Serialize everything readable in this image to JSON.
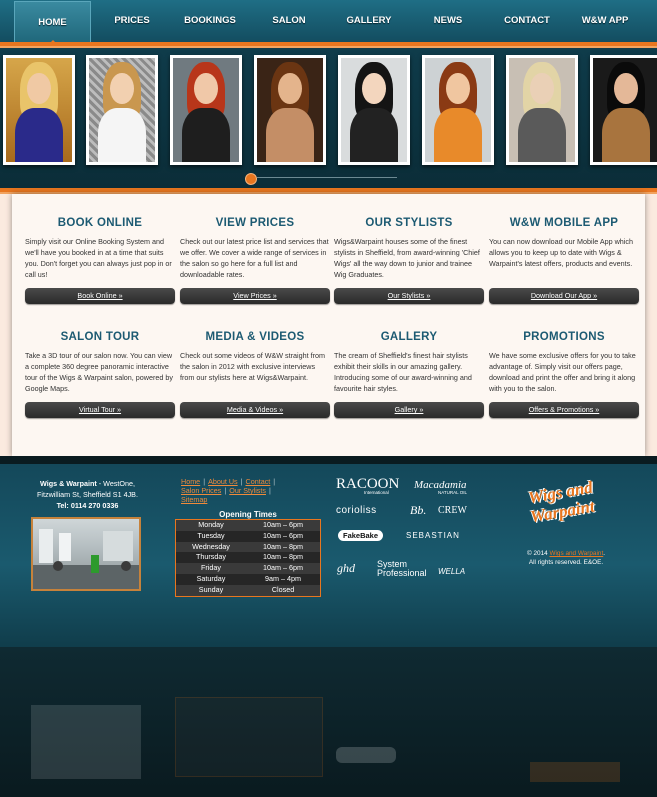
{
  "nav": {
    "items": [
      "HOME",
      "PRICES",
      "BOOKINGS",
      "SALON",
      "GALLERY",
      "NEWS",
      "CONTACT",
      "W&W APP"
    ],
    "active_index": 0
  },
  "colors": {
    "nav_bg": "#1b6175",
    "accent_orange": "#e8761f",
    "heading_blue": "#1c5a72",
    "panel_bg": "#fdf7f2",
    "button_dark": "#333333"
  },
  "carousel": {
    "photo_count": 8
  },
  "cards": [
    {
      "title": "BOOK ONLINE",
      "text": "Simply visit our Online Booking System and we'll have you booked in at a time that suits you. Don't forget you can always just pop in or call us!",
      "button": "Book Online »"
    },
    {
      "title": "VIEW PRICES",
      "text": "Check out our latest price list and services that we offer. We cover a wide range of services in the salon so go here for a full list and downloadable rates.",
      "button": "View Prices »"
    },
    {
      "title": "OUR STYLISTS",
      "text": "Wigs&Warpaint houses some of the finest stylists in Sheffield, from award-winning 'Chief Wigs' all the way down to junior and trainee Wig Graduates.",
      "button": "Our Stylists »"
    },
    {
      "title": "W&W MOBILE APP",
      "text": "You can now download our Mobile App which allows you to keep up to date with Wigs & Warpaint's latest offers, products and events.",
      "button": "Download Our App »"
    },
    {
      "title": "SALON TOUR",
      "text": "Take a 3D tour of our salon now. You can view a complete 360 degree panoramic interactive tour of the Wigs & Warpaint salon, powered by Google Maps.",
      "button": "Virtual Tour »"
    },
    {
      "title": "MEDIA & VIDEOS",
      "text": "Check out some videos of W&W straight from the salon in 2012 with exclusive interviews from our stylists here at Wigs&Warpaint.",
      "button": "Media & Videos »"
    },
    {
      "title": "GALLERY",
      "text": "The cream of Sheffield's finest hair stylists exhibit their skills in our amazing gallery. Introducing some of our award-winning and favourite hair styles.",
      "button": "Gallery »"
    },
    {
      "title": "PROMOTIONS",
      "text": "We have some exclusive offers for you to take advantage of. Simply visit our offers page, download and print the offer and bring it along with you to the salon.",
      "button": "Offers & Promotions »"
    }
  ],
  "footer": {
    "address_name": "Wigs & Warpaint",
    "address_rest": " - WestOne,",
    "address_line2": "Fitzwilliam St, Sheffield S1 4JB.",
    "tel_label": "Tel:",
    "tel": "0114 270 0336",
    "links": [
      "Home",
      "About Us",
      "Contact",
      "Salon Prices",
      "Our Stylists",
      "Sitemap"
    ],
    "hours_title": "Opening Times",
    "hours": [
      {
        "day": "Monday",
        "time": "10am – 6pm"
      },
      {
        "day": "Tuesday",
        "time": "10am – 6pm"
      },
      {
        "day": "Wednesday",
        "time": "10am – 8pm"
      },
      {
        "day": "Thursday",
        "time": "10am – 8pm"
      },
      {
        "day": "Friday",
        "time": "10am – 6pm"
      },
      {
        "day": "Saturday",
        "time": "9am – 4pm"
      },
      {
        "day": "Sunday",
        "time": "Closed"
      }
    ],
    "brands": {
      "racoon": "RACOON",
      "racoon_sub": "International",
      "macadamia": "Macadamia",
      "macadamia_sub": "NATURAL OIL",
      "corioliss": "corioliss",
      "bb": "Bb.",
      "crew": "CREW",
      "fakebake": "FakeBake",
      "sebastian": "SEBASTIAN",
      "ghd": "ghd",
      "system": "System",
      "professional": "Professional",
      "wella": "WELLA"
    },
    "logo_line1": "Wigs and",
    "logo_line2": "Warpaint",
    "copy_prefix": "© 2014",
    "copy_link": "Wigs and Warpaint",
    "copy_line2": "All rights reserved. E&OE."
  }
}
